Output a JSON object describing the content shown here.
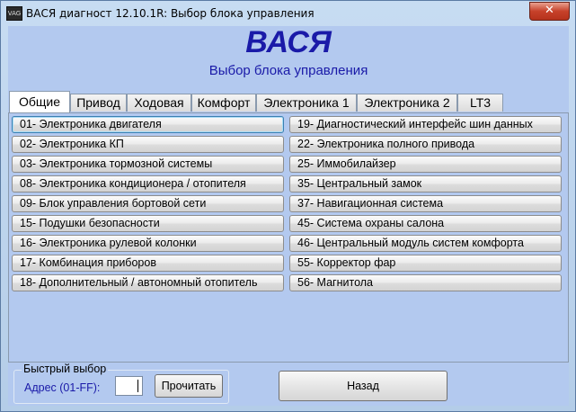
{
  "window": {
    "title": "ВАСЯ диагност 12.10.1R:  Выбор блока управления",
    "close_label": "✕",
    "icon_label": "VAG"
  },
  "header": {
    "app_name": "ВАСЯ",
    "subtitle": "Выбор блока управления"
  },
  "tabs": [
    {
      "label": "Общие",
      "active": true
    },
    {
      "label": "Привод"
    },
    {
      "label": "Ходовая"
    },
    {
      "label": "Комфорт"
    },
    {
      "label": "Электроника 1"
    },
    {
      "label": "Электроника 2"
    },
    {
      "label": "LT3"
    }
  ],
  "modules_left": [
    "01- Электроника двигателя",
    "02- Электроника КП",
    "03- Электроника тормозной системы",
    "08- Электроника кондиционера / отопителя",
    "09- Блок управления бортовой сети",
    "15- Подушки безопасности",
    "16- Электроника рулевой колонки",
    "17- Комбинация приборов",
    "18- Дополнительный / автономный отопитель"
  ],
  "modules_right": [
    "19- Диагностический интерфейс шин данных",
    "22- Электроника полного привода",
    "25- Иммобилайзер",
    "35- Центральный замок",
    "37- Навигационная система",
    "45- Система охраны салона",
    "46- Центральный модуль систем комфорта",
    "55- Корректор фар",
    "56- Магнитола"
  ],
  "quick_select": {
    "group_label": "Быстрый выбор",
    "address_label": "Адрес (01-FF):",
    "address_value": "",
    "read_button": "Прочитать"
  },
  "back_button": "Назад"
}
